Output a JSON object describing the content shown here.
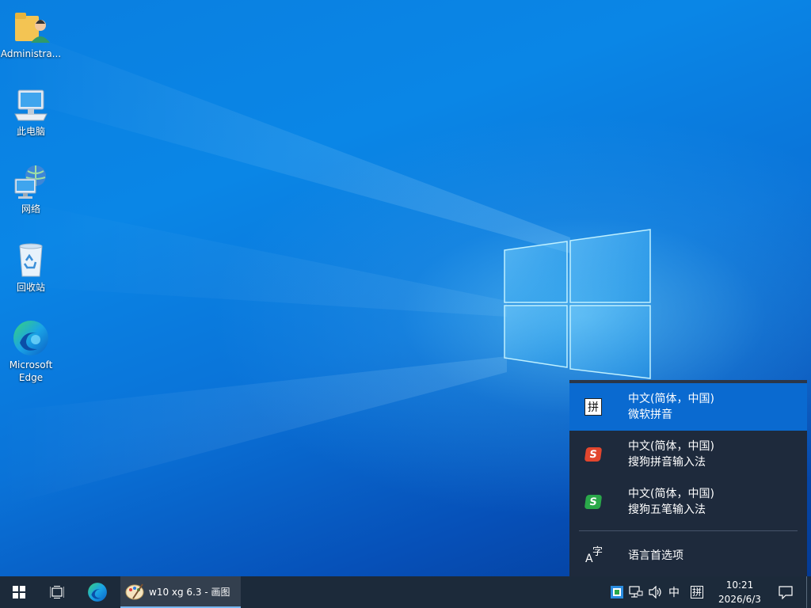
{
  "desktop": {
    "icons": [
      {
        "label": "Administra...",
        "icon": "user-folder-icon"
      },
      {
        "label": "此电脑",
        "icon": "computer-icon"
      },
      {
        "label": "网络",
        "icon": "network-icon"
      },
      {
        "label": "回收站",
        "icon": "recycle-bin-icon"
      },
      {
        "label": "Microsoft Edge",
        "icon": "edge-icon"
      }
    ]
  },
  "ime_flyout": {
    "items": [
      {
        "line1": "中文(简体，中国)",
        "line2": "微软拼音",
        "glyph": "拼",
        "icon": "microsoft-pinyin-icon",
        "selected": true
      },
      {
        "line1": "中文(简体，中国)",
        "line2": "搜狗拼音输入法",
        "glyph": "S",
        "icon": "sogou-pinyin-icon",
        "selected": false
      },
      {
        "line1": "中文(简体，中国)",
        "line2": "搜狗五笔输入法",
        "glyph": "S",
        "icon": "sogou-wubi-icon",
        "selected": false
      }
    ],
    "preferences_label": "语言首选项",
    "preferences_glyph_a": "A",
    "preferences_glyph_zi": "字"
  },
  "taskbar": {
    "app_label": "w10  xg 6.3 - 画图",
    "tray": {
      "ime_mode": "中",
      "ime_pin": "拼",
      "time": "10:21",
      "date": "2026/6/3"
    }
  },
  "colors": {
    "accent": "#0a6ad0",
    "taskbar": "#1c2a3a",
    "flyout": "#1e2a3c",
    "sogou_red": "#e2462e",
    "sogou_green": "#2aa84a"
  }
}
